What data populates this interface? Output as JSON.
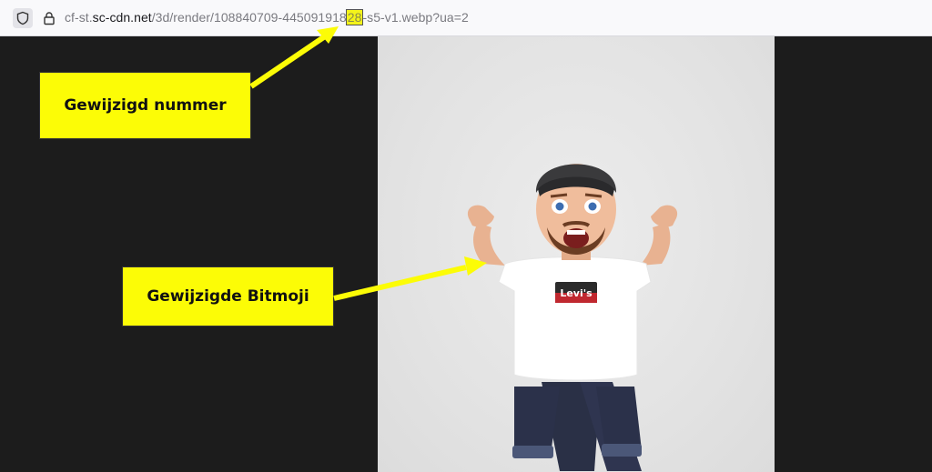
{
  "browser": {
    "url_prefix": "cf-st.",
    "url_host": "sc-cdn.net",
    "url_path_start": "/3d/render/108840709-445091918",
    "url_highlight": "28",
    "url_path_end": "-s5-v1.webp?ua=2",
    "icons": [
      "shield-icon",
      "lock-icon"
    ]
  },
  "annotations": {
    "callout_number": "Gewijzigd nummer",
    "callout_bitmoji": "Gewijzigde Bitmoji",
    "highlight_color": "#fcfc06"
  },
  "image": {
    "shirt_logo": "Levi's"
  }
}
